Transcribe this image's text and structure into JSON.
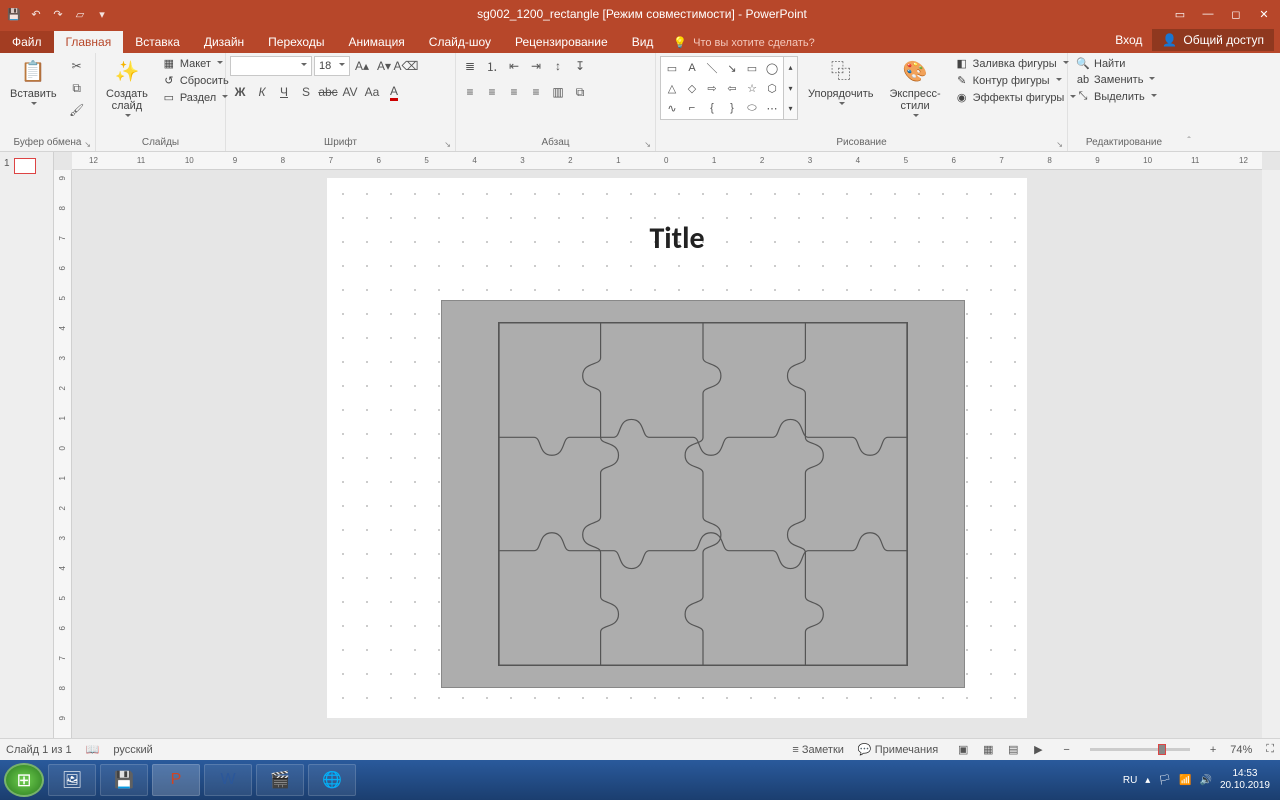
{
  "titlebar": {
    "document_title": "sg002_1200_rectangle [Режим совместимости] - PowerPoint"
  },
  "tabs": {
    "file": "Файл",
    "home": "Главная",
    "insert": "Вставка",
    "design": "Дизайн",
    "transitions": "Переходы",
    "animations": "Анимация",
    "slideshow": "Слайд-шоу",
    "review": "Рецензирование",
    "view": "Вид",
    "tell_me": "Что вы хотите сделать?",
    "signin": "Вход",
    "share": "Общий доступ"
  },
  "ribbon": {
    "clipboard": {
      "label": "Буфер обмена",
      "paste": "Вставить"
    },
    "slides": {
      "label": "Слайды",
      "new_slide": "Создать\nслайд",
      "layout": "Макет",
      "reset": "Сбросить",
      "section": "Раздел"
    },
    "font": {
      "label": "Шрифт",
      "font_name": "",
      "font_size": "18"
    },
    "paragraph": {
      "label": "Абзац"
    },
    "drawing": {
      "label": "Рисование",
      "arrange": "Упорядочить",
      "quick_styles": "Экспресс-\nстили",
      "shape_fill": "Заливка фигуры",
      "shape_outline": "Контур фигуры",
      "shape_effects": "Эффекты фигуры"
    },
    "editing": {
      "label": "Редактирование",
      "find": "Найти",
      "replace": "Заменить",
      "select": "Выделить"
    }
  },
  "slide": {
    "title_text": "Title",
    "thumb_number": "1"
  },
  "status": {
    "slide_of": "Слайд 1 из 1",
    "language": "русский",
    "notes": "Заметки",
    "comments": "Примечания",
    "zoom": "74%"
  },
  "ruler": {
    "h_labels": [
      "12",
      "11",
      "10",
      "9",
      "8",
      "7",
      "6",
      "5",
      "4",
      "3",
      "2",
      "1",
      "0",
      "1",
      "2",
      "3",
      "4",
      "5",
      "6",
      "7",
      "8",
      "9",
      "10",
      "11",
      "12"
    ],
    "v_labels": [
      "9",
      "8",
      "7",
      "6",
      "5",
      "4",
      "3",
      "2",
      "1",
      "0",
      "1",
      "2",
      "3",
      "4",
      "5",
      "6",
      "7",
      "8",
      "9"
    ]
  },
  "taskbar": {
    "lang": "RU",
    "time": "14:53",
    "date": "20.10.2019"
  }
}
